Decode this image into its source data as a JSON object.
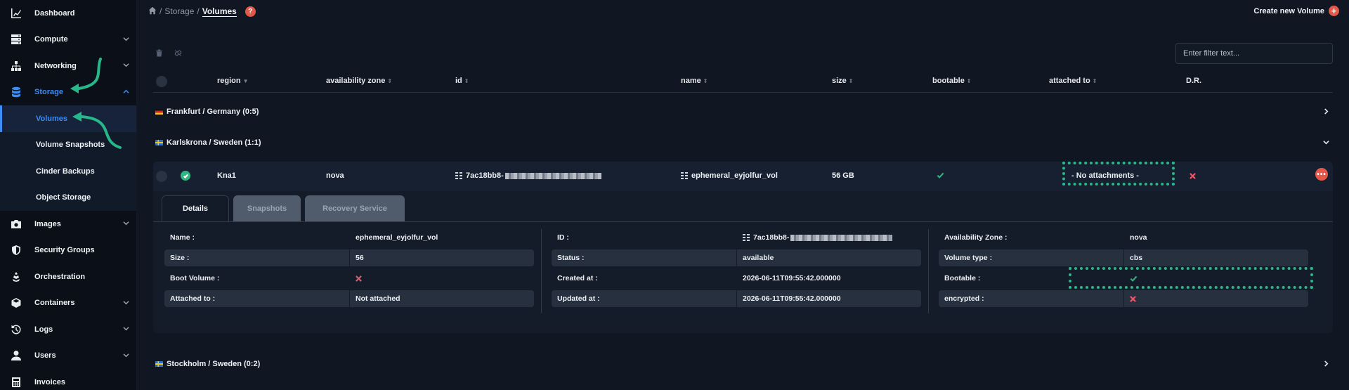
{
  "sidebar": {
    "items": [
      {
        "label": "Dashboard",
        "icon": "chart-icon",
        "chevron": false
      },
      {
        "label": "Compute",
        "icon": "server-icon",
        "chevron": true
      },
      {
        "label": "Networking",
        "icon": "network-icon",
        "chevron": true
      },
      {
        "label": "Storage",
        "icon": "database-icon",
        "chevron": true,
        "active": true
      },
      {
        "label": "Images",
        "icon": "camera-icon",
        "chevron": true
      },
      {
        "label": "Security Groups",
        "icon": "shield-icon",
        "chevron": false
      },
      {
        "label": "Orchestration",
        "icon": "orchestration-icon",
        "chevron": false
      },
      {
        "label": "Containers",
        "icon": "cube-icon",
        "chevron": true
      },
      {
        "label": "Logs",
        "icon": "history-icon",
        "chevron": true
      },
      {
        "label": "Users",
        "icon": "user-icon",
        "chevron": true
      },
      {
        "label": "Invoices",
        "icon": "calculator-icon",
        "chevron": false
      }
    ],
    "storage_sub": [
      "Volumes",
      "Volume Snapshots",
      "Cinder Backups",
      "Object Storage"
    ]
  },
  "breadcrumb": {
    "sep": "/",
    "parent": "Storage",
    "current": "Volumes",
    "help": "?"
  },
  "header": {
    "create_label": "Create new Volume"
  },
  "filter": {
    "placeholder": "Enter filter text..."
  },
  "table": {
    "columns": [
      "region",
      "availability zone",
      "id",
      "name",
      "size",
      "bootable",
      "attached to",
      "D.R."
    ],
    "groups": [
      {
        "label": "Frankfurt / Germany (0:5)"
      },
      {
        "label": "Karlskrona / Sweden (1:1)"
      },
      {
        "label": "Stockholm / Sweden (0:2)"
      }
    ],
    "volume": {
      "region": "Kna1",
      "zone": "nova",
      "id_prefix": "7ac18bb8-",
      "name": "ephemeral_eyjolfur_vol",
      "size": "56 GB",
      "attached": "- No attachments -"
    }
  },
  "tabs": [
    "Details",
    "Snapshots",
    "Recovery Service"
  ],
  "details": {
    "col1": [
      {
        "k": "Name :",
        "v": "ephemeral_eyjolfur_vol"
      },
      {
        "k": "Size :",
        "v": "56"
      },
      {
        "k": "Boot Volume :",
        "v": ""
      },
      {
        "k": "Attached to :",
        "v": "Not attached"
      }
    ],
    "col2": [
      {
        "k": "ID :",
        "v": "7ac18bb8-"
      },
      {
        "k": "Status :",
        "v": "available"
      },
      {
        "k": "Created at :",
        "v": "2026-06-11T09:55:42.000000"
      },
      {
        "k": "Updated at :",
        "v": "2026-06-11T09:55:42.000000"
      }
    ],
    "col3": [
      {
        "k": "Availability Zone :",
        "v": "nova"
      },
      {
        "k": "Volume type :",
        "v": "cbs"
      },
      {
        "k": "Bootable :",
        "v": ""
      },
      {
        "k": "encrypted :",
        "v": ""
      }
    ]
  },
  "colors": {
    "accent": "#3c8df5",
    "annotation": "#27b88a",
    "danger": "#e4584a",
    "success": "#31b882"
  }
}
